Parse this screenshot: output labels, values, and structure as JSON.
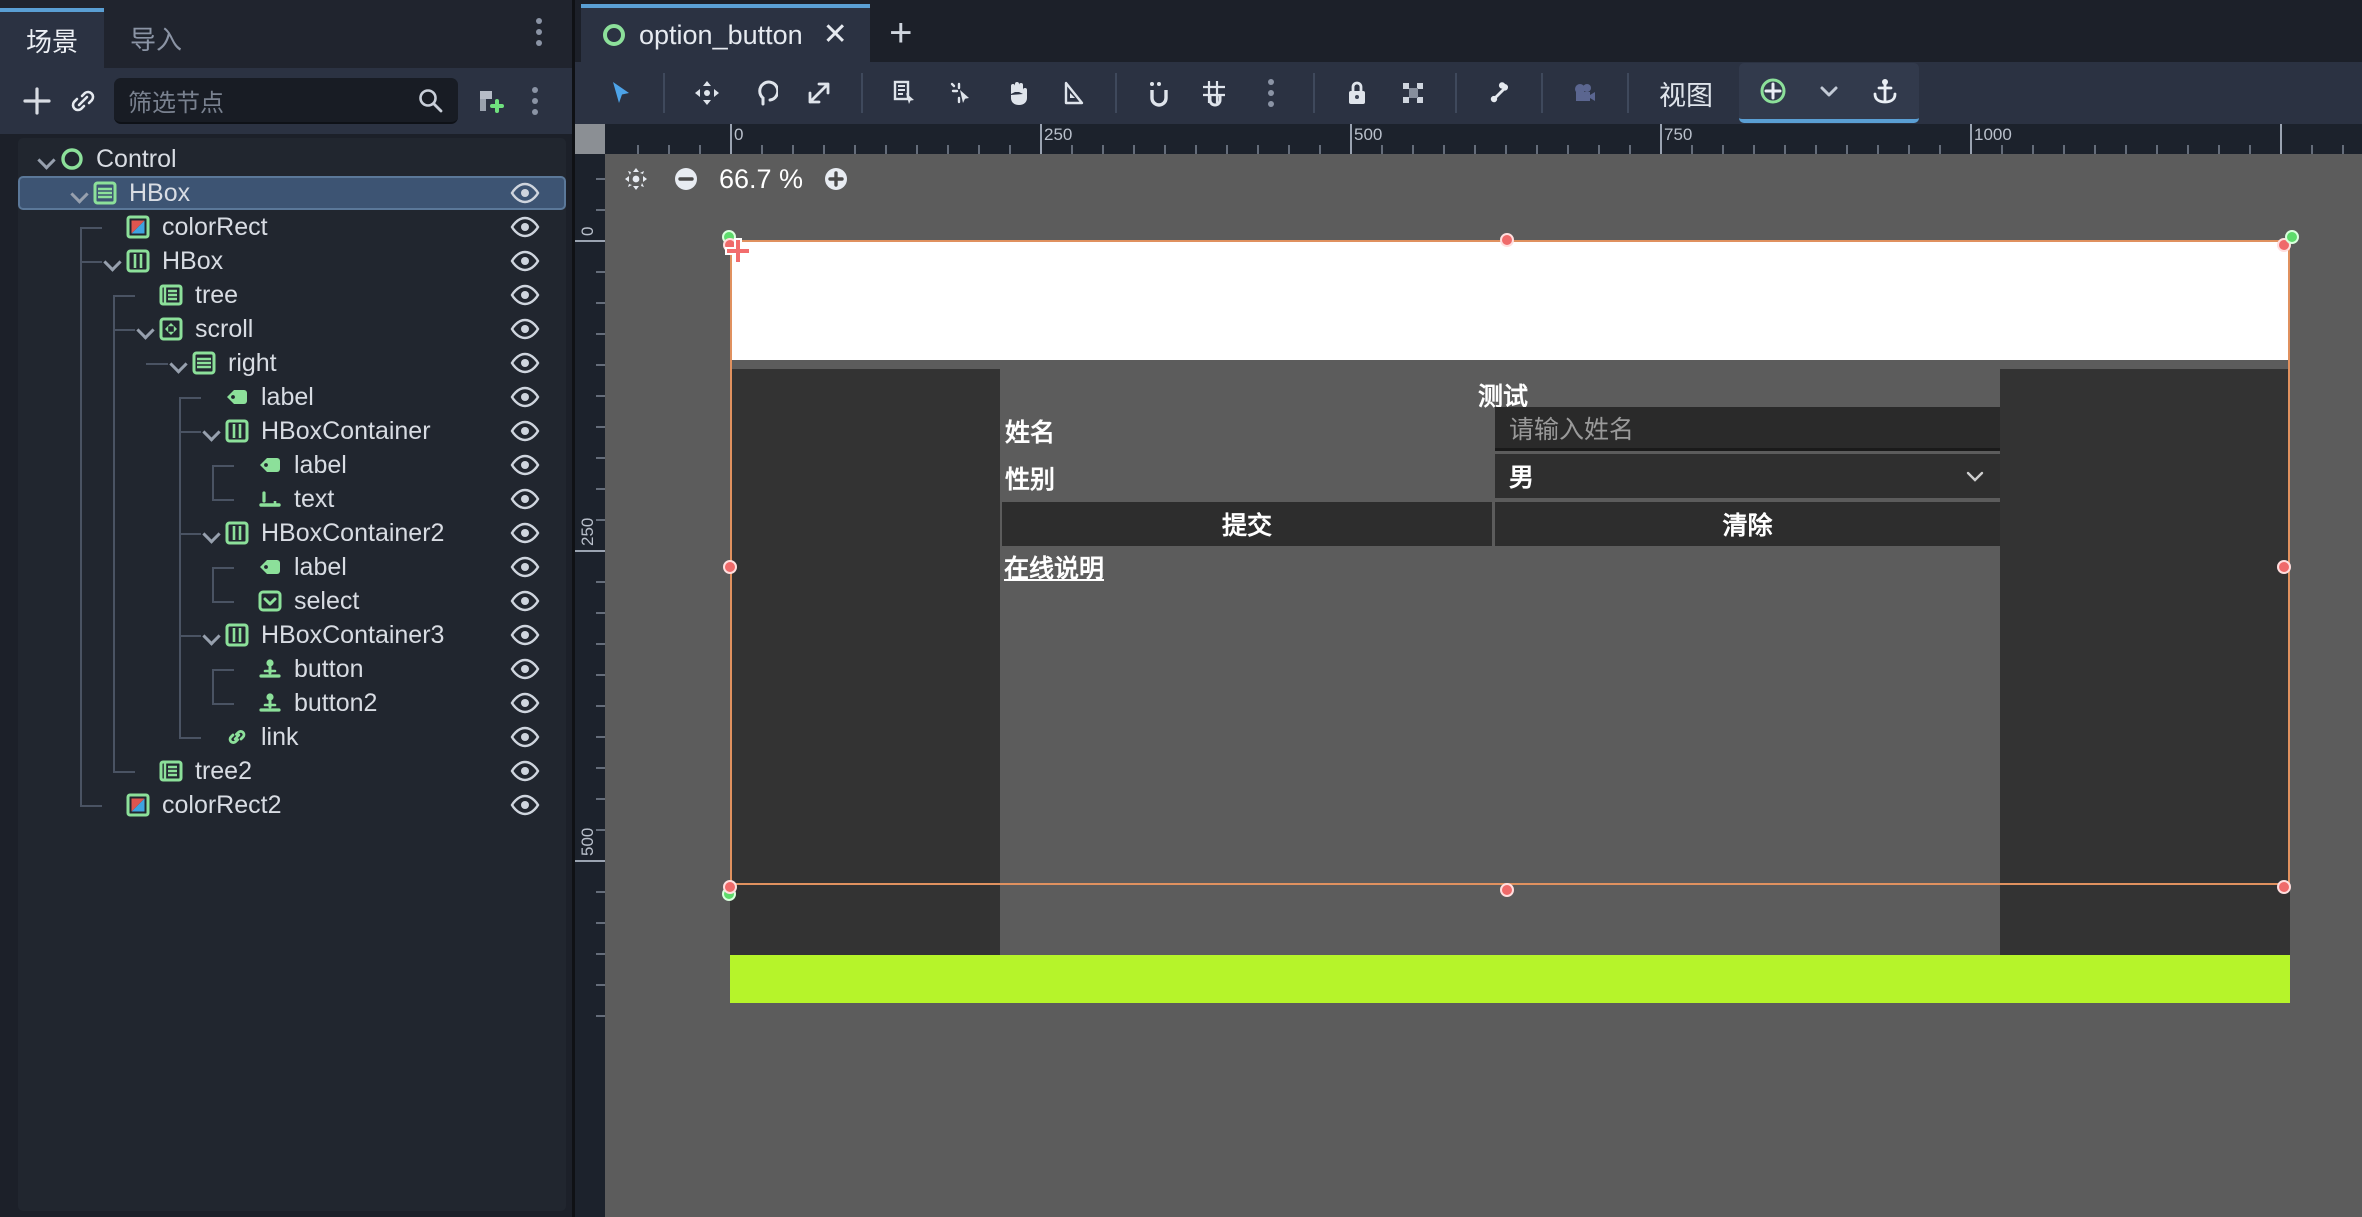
{
  "dock": {
    "tabs": [
      {
        "label": "场景",
        "active": true
      },
      {
        "label": "导入",
        "active": false
      }
    ],
    "toolbar": {
      "add_icon": "plus-icon",
      "link_icon": "link-icon",
      "filter_placeholder": "筛选节点",
      "search_icon": "search-icon",
      "attach_script_icon": "script-add-icon",
      "more_icon": "vertical-dots-icon"
    },
    "tree": [
      {
        "label": "Control",
        "depth": 0,
        "icon": "control-node-icon",
        "expanded": true,
        "selected": false,
        "visible_toggle": false
      },
      {
        "label": "HBox",
        "depth": 1,
        "icon": "vbox-container-icon",
        "expanded": true,
        "selected": true,
        "visible_toggle": true
      },
      {
        "label": "colorRect",
        "depth": 2,
        "icon": "color-rect-icon",
        "expanded": null,
        "selected": false,
        "visible_toggle": true
      },
      {
        "label": "HBox",
        "depth": 2,
        "icon": "hbox-container-icon",
        "expanded": true,
        "selected": false,
        "visible_toggle": true
      },
      {
        "label": "tree",
        "depth": 3,
        "icon": "tree-node-icon",
        "expanded": null,
        "selected": false,
        "visible_toggle": true
      },
      {
        "label": "scroll",
        "depth": 3,
        "icon": "scroll-container-icon",
        "expanded": true,
        "selected": false,
        "visible_toggle": true
      },
      {
        "label": "right",
        "depth": 4,
        "icon": "vbox-container-icon",
        "expanded": true,
        "selected": false,
        "visible_toggle": true
      },
      {
        "label": "label",
        "depth": 5,
        "icon": "label-icon",
        "expanded": null,
        "selected": false,
        "visible_toggle": true
      },
      {
        "label": "HBoxContainer",
        "depth": 5,
        "icon": "hbox-container-icon",
        "expanded": true,
        "selected": false,
        "visible_toggle": true
      },
      {
        "label": "label",
        "depth": 6,
        "icon": "label-icon",
        "expanded": null,
        "selected": false,
        "visible_toggle": true
      },
      {
        "label": "text",
        "depth": 6,
        "icon": "line-edit-icon",
        "expanded": null,
        "selected": false,
        "visible_toggle": true
      },
      {
        "label": "HBoxContainer2",
        "depth": 5,
        "icon": "hbox-container-icon",
        "expanded": true,
        "selected": false,
        "visible_toggle": true
      },
      {
        "label": "label",
        "depth": 6,
        "icon": "label-icon",
        "expanded": null,
        "selected": false,
        "visible_toggle": true
      },
      {
        "label": "select",
        "depth": 6,
        "icon": "option-button-icon",
        "expanded": null,
        "selected": false,
        "visible_toggle": true
      },
      {
        "label": "HBoxContainer3",
        "depth": 5,
        "icon": "hbox-container-icon",
        "expanded": true,
        "selected": false,
        "visible_toggle": true
      },
      {
        "label": "button",
        "depth": 6,
        "icon": "button-icon",
        "expanded": null,
        "selected": false,
        "visible_toggle": true
      },
      {
        "label": "button2",
        "depth": 6,
        "icon": "button-icon",
        "expanded": null,
        "selected": false,
        "visible_toggle": true
      },
      {
        "label": "link",
        "depth": 5,
        "icon": "link-button-icon",
        "expanded": null,
        "selected": false,
        "visible_toggle": true
      },
      {
        "label": "tree2",
        "depth": 3,
        "icon": "tree-node-icon",
        "expanded": null,
        "selected": false,
        "visible_toggle": true
      },
      {
        "label": "colorRect2",
        "depth": 2,
        "icon": "color-rect-icon",
        "expanded": null,
        "selected": false,
        "visible_toggle": true
      }
    ]
  },
  "scene_tabs": {
    "current": "option_button",
    "close_label": "✕",
    "new_tab_label": "+"
  },
  "edit_toolbar": {
    "tools": [
      {
        "name": "select-tool-icon",
        "active": true
      },
      {
        "name": "move-tool-icon",
        "active": false
      },
      {
        "name": "rotate-tool-icon",
        "active": false
      },
      {
        "name": "scale-tool-icon",
        "active": false
      },
      {
        "name": "list-select-tool-icon",
        "active": false
      },
      {
        "name": "ruler-select-icon",
        "active": false
      },
      {
        "name": "pan-tool-icon",
        "active": false
      },
      {
        "name": "ruler-tool-icon",
        "active": false
      },
      {
        "name": "snap-magnet-icon",
        "active": false
      },
      {
        "name": "grid-snap-icon",
        "active": false
      },
      {
        "name": "snap-options-dots-icon",
        "active": false
      },
      {
        "name": "lock-icon",
        "active": false
      },
      {
        "name": "group-icon",
        "active": false
      },
      {
        "name": "skeleton-bone-icon",
        "active": false
      },
      {
        "name": "camera-preview-icon",
        "active": false
      }
    ],
    "view_label": "视图",
    "anchor_add_icon": "add-anchor-icon",
    "anchor_dropdown_icon": "chevron-down-icon",
    "anchor_icon": "anchor-icon"
  },
  "viewport": {
    "zoom": {
      "fit_icon": "zoom-fit-icon",
      "minus_icon": "zoom-out-icon",
      "value": "66.7 %",
      "plus_icon": "zoom-in-icon"
    },
    "ruler_h_labels": [
      "0",
      "250",
      "500",
      "750",
      "1000"
    ],
    "ruler_v_labels": [
      "0",
      "250",
      "500"
    ]
  },
  "scene_preview": {
    "title": "测试",
    "fields": [
      {
        "label": "姓名",
        "type": "input",
        "placeholder": "请输入姓名",
        "value": ""
      },
      {
        "label": "性别",
        "type": "select",
        "value": "男"
      }
    ],
    "buttons": [
      {
        "label": "提交"
      },
      {
        "label": "清除"
      }
    ],
    "link": "在线说明",
    "colors": {
      "white_rect": "#ffffff",
      "green_rect": "#b6f42a",
      "panel_bg": "#5c5c5c",
      "dark_panel": "#333333",
      "selection": "#e0915f"
    }
  }
}
